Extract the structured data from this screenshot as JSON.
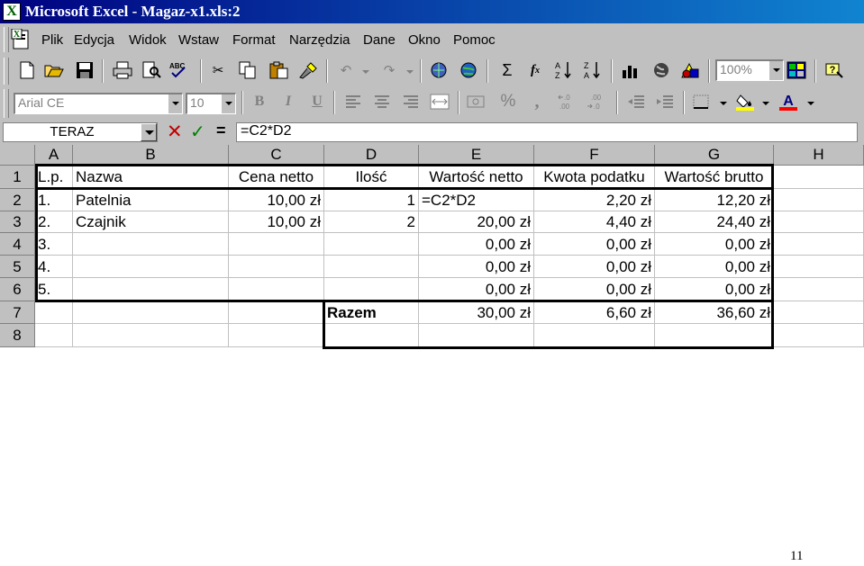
{
  "window": {
    "title": "Microsoft Excel - Magaz-x1.xls:2",
    "app_icon_letter": "X"
  },
  "menu": {
    "items": [
      "Plik",
      "Edycja",
      "Widok",
      "Wstaw",
      "Format",
      "Narzędzia",
      "Dane",
      "Okno",
      "Pomoc"
    ]
  },
  "standard_toolbar": {
    "zoom": "100%"
  },
  "formatting_toolbar": {
    "font": "Arial CE",
    "size": "10",
    "bold": "B",
    "italic": "I",
    "underline": "U",
    "percent": "%",
    "comma": ","
  },
  "formula_bar": {
    "name_box": "TERAZ",
    "equals": "=",
    "formula": "=C2*D2"
  },
  "columns": [
    "A",
    "B",
    "C",
    "D",
    "E",
    "F",
    "G",
    "H"
  ],
  "rows": [
    "1",
    "2",
    "3",
    "4",
    "5",
    "6",
    "7",
    "8"
  ],
  "cells": {
    "A1": "L.p.",
    "B1": "Nazwa",
    "C1": "Cena netto",
    "D1": "Ilość",
    "E1": "Wartość netto",
    "F1": "Kwota podatku",
    "G1": "Wartość brutto",
    "A2": "1.",
    "B2": "Patelnia",
    "C2": "10,00 zł",
    "D2": "1",
    "E2": "=C2*D2",
    "F2": "2,20 zł",
    "G2": "12,20 zł",
    "A3": "2.",
    "B3": "Czajnik",
    "C3": "10,00 zł",
    "D3": "2",
    "E3": "20,00 zł",
    "F3": "4,40 zł",
    "G3": "24,40 zł",
    "A4": "3.",
    "E4": "0,00 zł",
    "F4": "0,00 zł",
    "G4": "0,00 zł",
    "A5": "4.",
    "E5": "0,00 zł",
    "F5": "0,00 zł",
    "G5": "0,00 zł",
    "A6": "5.",
    "E6": "0,00 zł",
    "F6": "0,00 zł",
    "G6": "0,00 zł",
    "D7": "Razem",
    "E7": "30,00 zł",
    "F7": "6,60 zł",
    "G7": "36,60 zł"
  },
  "page_number": "11",
  "colors": {
    "title_gradient_start": "#000080",
    "title_gradient_end": "#1084d0",
    "chrome": "#c0c0c0",
    "cancel_red": "#c00000",
    "enter_green": "#008000"
  }
}
